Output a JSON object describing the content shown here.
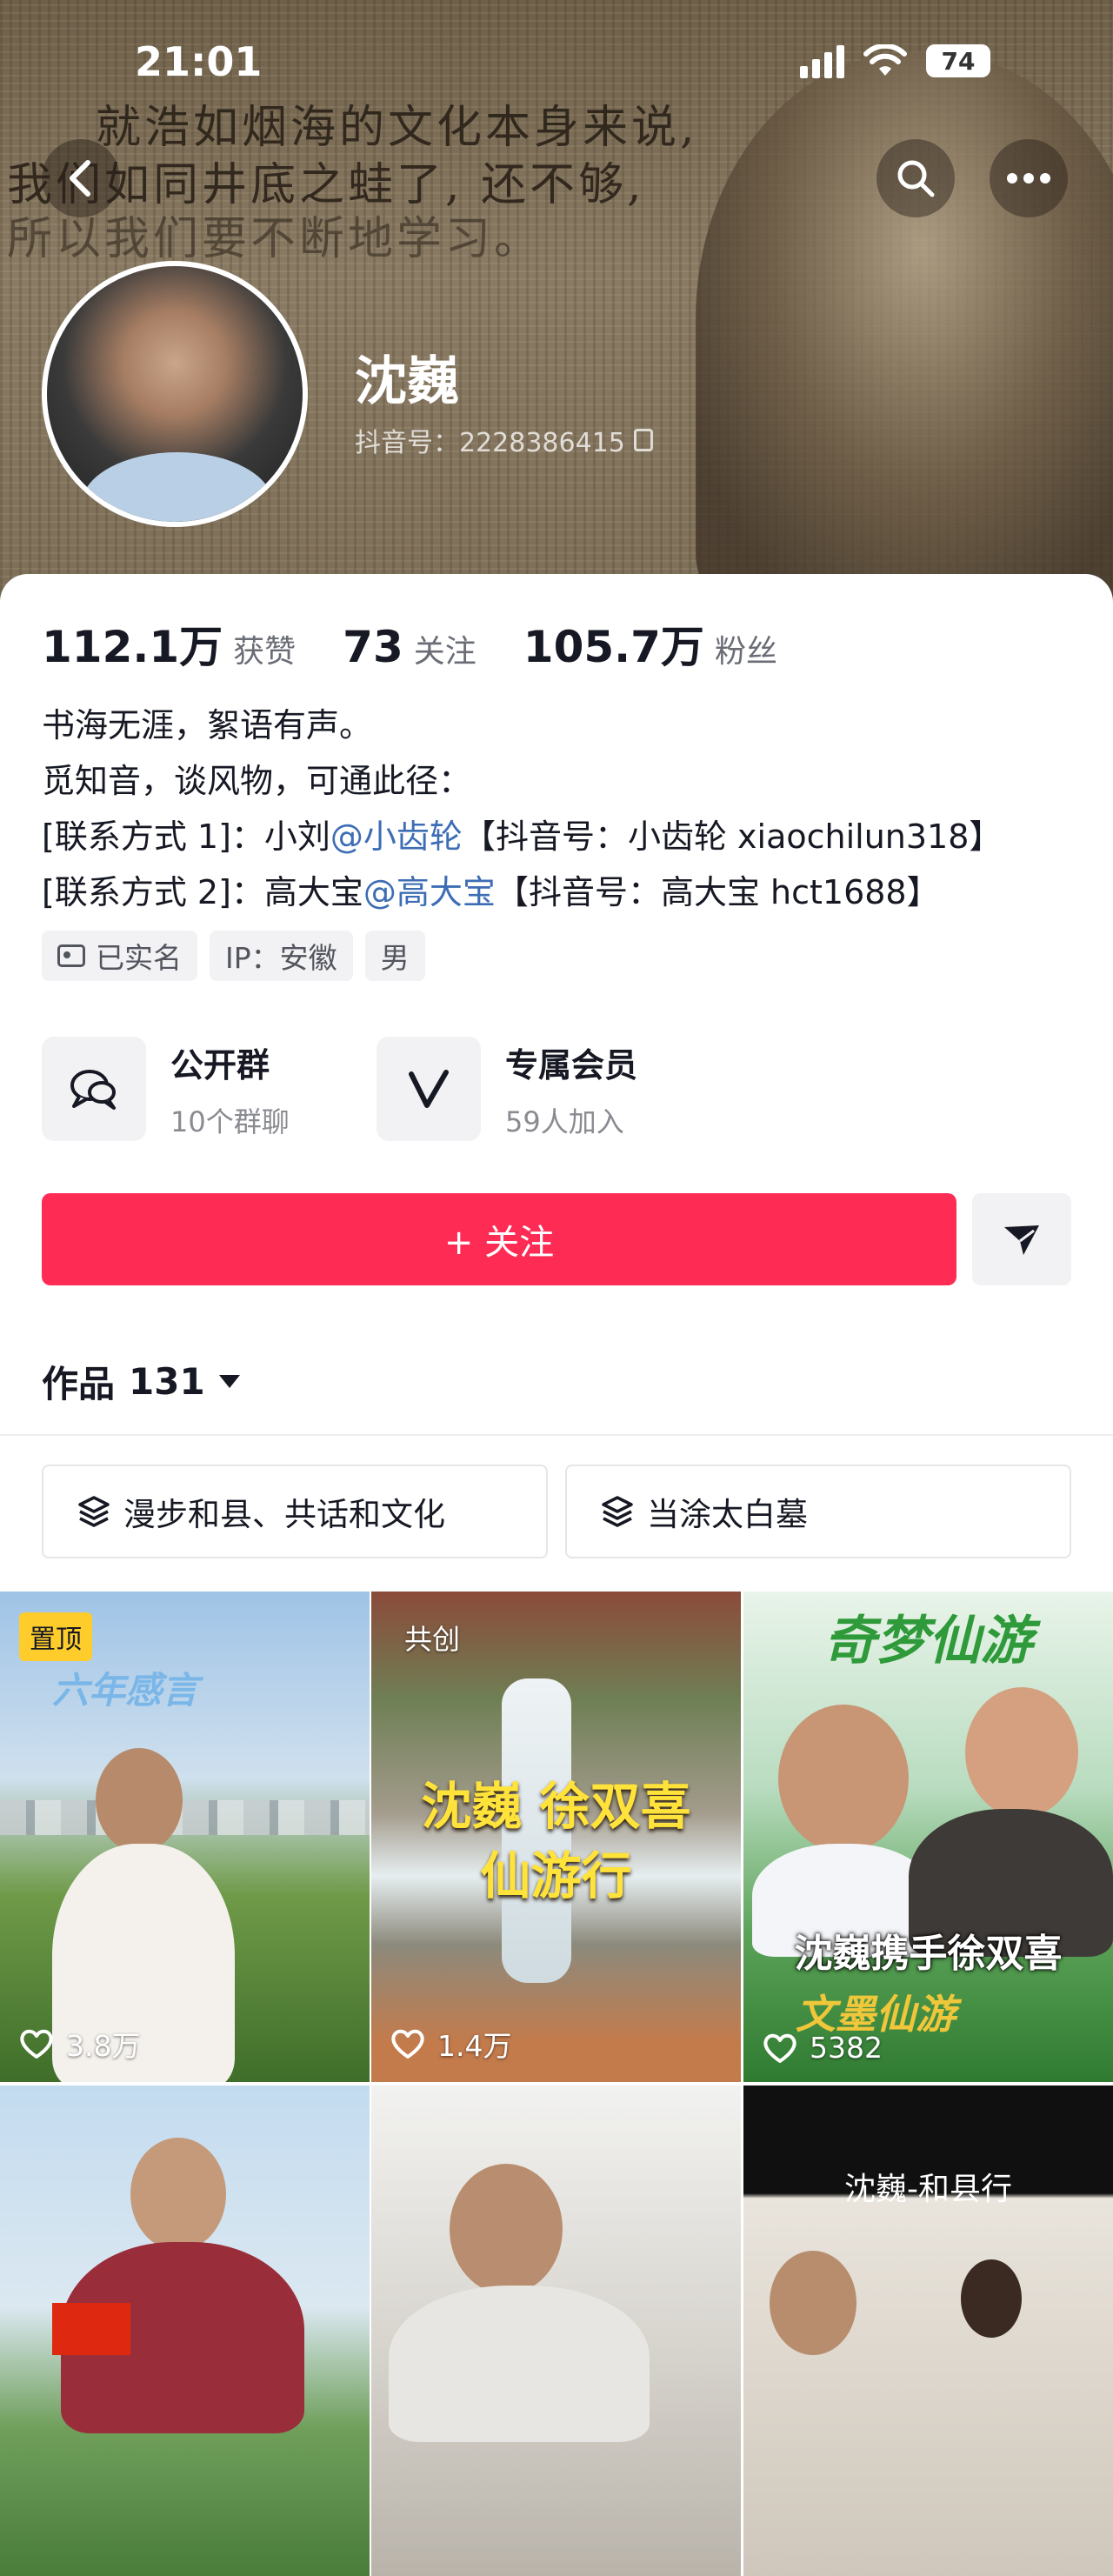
{
  "status_bar": {
    "time": "21:01",
    "battery": "74"
  },
  "banner": {
    "lines": [
      "就浩如烟海的文化本身来说,",
      "我们如同井底之蛙了, 还不够,",
      "所以我们要不断地学习。"
    ]
  },
  "profile": {
    "name": "沈巍",
    "douyin_id": "抖音号：2228386415"
  },
  "stats": [
    {
      "value": "112.1万",
      "label": "获赞"
    },
    {
      "value": "73",
      "label": "关注"
    },
    {
      "value": "105.7万",
      "label": "粉丝"
    }
  ],
  "bio": {
    "line1": "书海无涯，絮语有声。",
    "line2": "觅知音，谈风物，可通此径：",
    "line3_pre": "[联系方式 1]：小刘",
    "line3_mention": "@小齿轮",
    "line3_post": "【抖音号：小齿轮 xiaochilun318】",
    "line4_pre": "[联系方式 2]：高大宝",
    "line4_mention": "@高大宝",
    "line4_post": "【抖音号：高大宝 hct1688】"
  },
  "tags": {
    "verified": "已实名",
    "ip": "IP：安徽",
    "gender": "男"
  },
  "features": {
    "group": {
      "title": "公开群",
      "sub": "10个群聊"
    },
    "member": {
      "title": "专属会员",
      "sub": "59人加入"
    }
  },
  "actions": {
    "follow": "+ 关注"
  },
  "works": {
    "label": "作品",
    "count": "131"
  },
  "collections": [
    "漫步和县、共话和文化",
    "当涂太白墓"
  ],
  "videos": [
    {
      "badge": "置顶",
      "overlay": "六年感言",
      "likes": "3.8万"
    },
    {
      "badge": "共创",
      "overlay": "沈巍 徐双喜 仙游行",
      "overlay_line1": "沈巍 徐双喜",
      "overlay_line2": "仙游行",
      "likes": "1.4万"
    },
    {
      "overlay_top": "奇梦仙游",
      "overlay": "沈巍携手徐双喜",
      "overlay_bottom": "文墨仙游",
      "likes": "5382"
    },
    {
      "overlay": ""
    },
    {
      "overlay": ""
    },
    {
      "overlay": "沈巍-和县行"
    }
  ],
  "colors": {
    "accent": "#fe2c55",
    "mention": "#3d6db5",
    "pin_badge": "#fecd2c"
  }
}
